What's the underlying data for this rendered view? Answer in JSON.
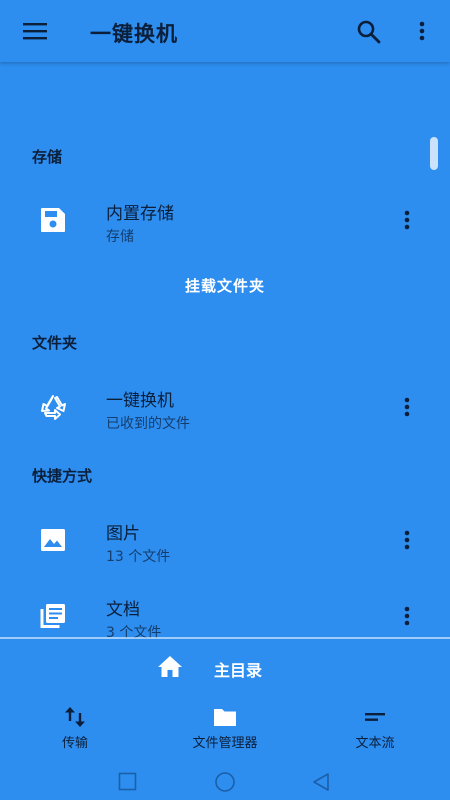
{
  "appbar": {
    "title": "一键换机",
    "menu_icon": "menu-icon",
    "search_icon": "search-icon",
    "more_icon": "more-vert-icon"
  },
  "sections": {
    "storage": "存储",
    "folders": "文件夹",
    "shortcuts": "快捷方式"
  },
  "rows": [
    {
      "title": "内置存储",
      "subtitle": "存储",
      "icon": "storage-icon"
    },
    {
      "title": "一键换机",
      "subtitle": "已收到的文件",
      "icon": "recycle-icon"
    },
    {
      "title": "图片",
      "subtitle": "13 个文件",
      "icon": "image-icon"
    },
    {
      "title": "文档",
      "subtitle": "3 个文件",
      "icon": "documents-icon"
    }
  ],
  "mount_folder": "挂载文件夹",
  "home": {
    "label": "主目录",
    "icon": "home-icon"
  },
  "bottom_nav": [
    {
      "label": "传输",
      "icon": "swap-vert-icon"
    },
    {
      "label": "文件管理器",
      "icon": "folder-icon"
    },
    {
      "label": "文本流",
      "icon": "text-stream-icon"
    }
  ],
  "colors": {
    "background": "#2d8ef0",
    "text_dark": "#0b1f3a",
    "text_light": "#ffffff"
  }
}
